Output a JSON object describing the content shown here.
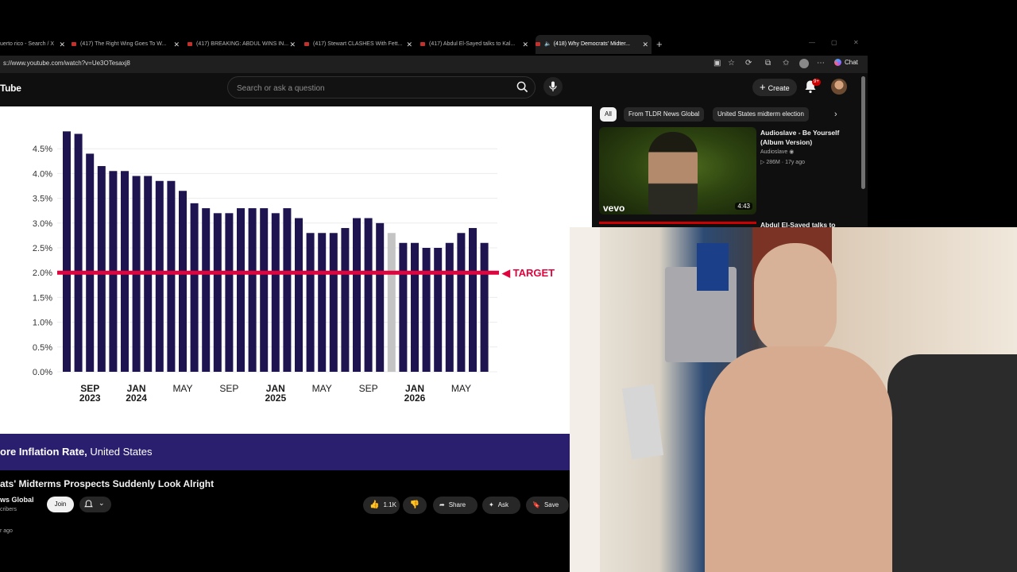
{
  "browser": {
    "tabs": [
      {
        "label": "uerto rico - Search / X",
        "active": false
      },
      {
        "label": "(417) The Right Wing Goes To W...",
        "active": false
      },
      {
        "label": "(417) BREAKING: ABDUL WINS IN...",
        "active": false
      },
      {
        "label": "(417) Stewart CLASHES With Fett...",
        "active": false
      },
      {
        "label": "(417) Abdul El-Sayed talks to Kal...",
        "active": false
      },
      {
        "label": "(418) Why Democrats' Midter...",
        "active": true
      }
    ],
    "url": "s://www.youtube.com/watch?v=Ue3OTesaxj8",
    "chat_label": "Chat"
  },
  "youtube": {
    "logo_text": "Tube",
    "search_placeholder": "Search or ask a question",
    "create_label": "Create",
    "notifications_count": "9+"
  },
  "chart_data": {
    "type": "bar",
    "title": "",
    "ylabel": "",
    "ylim": [
      0,
      5
    ],
    "yticks": [
      "0.0%",
      "0.5%",
      "1.0%",
      "1.5%",
      "2.0%",
      "2.5%",
      "3.0%",
      "3.5%",
      "4.0%",
      "4.5%"
    ],
    "x_tick_labels": [
      {
        "month": "SEP",
        "year": "2023"
      },
      {
        "month": "JAN",
        "year": "2024"
      },
      {
        "month": "MAY",
        "year": ""
      },
      {
        "month": "SEP",
        "year": ""
      },
      {
        "month": "JAN",
        "year": "2025"
      },
      {
        "month": "MAY",
        "year": ""
      },
      {
        "month": "SEP",
        "year": ""
      },
      {
        "month": "JAN",
        "year": "2026"
      },
      {
        "month": "MAY",
        "year": ""
      }
    ],
    "values": [
      4.85,
      4.8,
      4.4,
      4.15,
      4.05,
      4.05,
      3.95,
      3.95,
      3.85,
      3.85,
      3.65,
      3.4,
      3.3,
      3.2,
      3.2,
      3.3,
      3.3,
      3.3,
      3.2,
      3.3,
      3.1,
      2.8,
      2.8,
      2.8,
      2.9,
      3.1,
      3.1,
      3.0,
      2.8,
      2.6,
      2.6,
      2.5,
      2.5,
      2.6,
      2.8,
      2.9,
      2.6
    ],
    "missing_index": 28,
    "target": 2.0,
    "target_label": "◀ TARGET",
    "bar_color": "#1e1450",
    "missing_color": "#c4c4c4",
    "target_color": "#e0043e"
  },
  "caption": {
    "bold": "ore Inflation Rate,",
    "rest": " United States"
  },
  "video": {
    "title": "ats' Midterms Prospects Suddenly Look Alright",
    "channel": "ws Global",
    "subscribers": "cribers",
    "join_label": "Join",
    "likes": "1.1K",
    "share_label": "Share",
    "ask_label": "Ask",
    "save_label": "Save",
    "time_ago": "r ago"
  },
  "sidebar": {
    "chips": [
      "All",
      "From TLDR News Global",
      "United States midterm election"
    ],
    "recommendations": [
      {
        "title": "Audioslave - Be Yourself (Album Version)",
        "channel": "Audioslave",
        "views": "286M",
        "age": "17y ago",
        "duration": "4:43",
        "brand": "vevo"
      },
      {
        "title": "Abdul El-Sayed talks to"
      }
    ]
  }
}
